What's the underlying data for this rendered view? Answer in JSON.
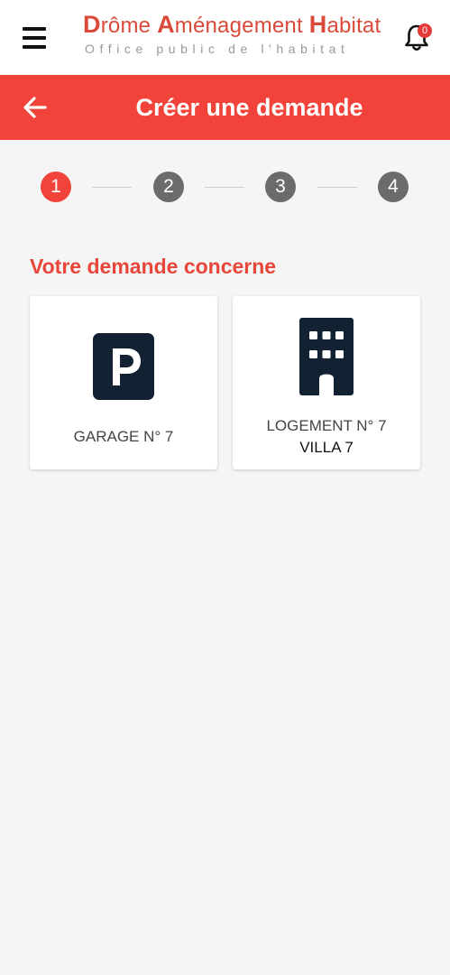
{
  "app": {
    "logo_parts": [
      {
        "cap": "D",
        "rest": "rôme "
      },
      {
        "cap": "A",
        "rest": "ménagement "
      },
      {
        "cap": "H",
        "rest": "abitat"
      }
    ],
    "logo_subtitle": "Office public de l'habitat",
    "notification_count": "0",
    "accent_color": "#f2433a"
  },
  "header": {
    "title": "Créer une demande"
  },
  "stepper": {
    "steps": [
      "1",
      "2",
      "3",
      "4"
    ],
    "active_index": 0
  },
  "section": {
    "title": "Votre demande concerne"
  },
  "options": [
    {
      "icon": "parking-icon",
      "label": "GARAGE N° 7",
      "sublabel": ""
    },
    {
      "icon": "building-icon",
      "label": "LOGEMENT N° 7",
      "sublabel": "VILLA 7"
    }
  ]
}
